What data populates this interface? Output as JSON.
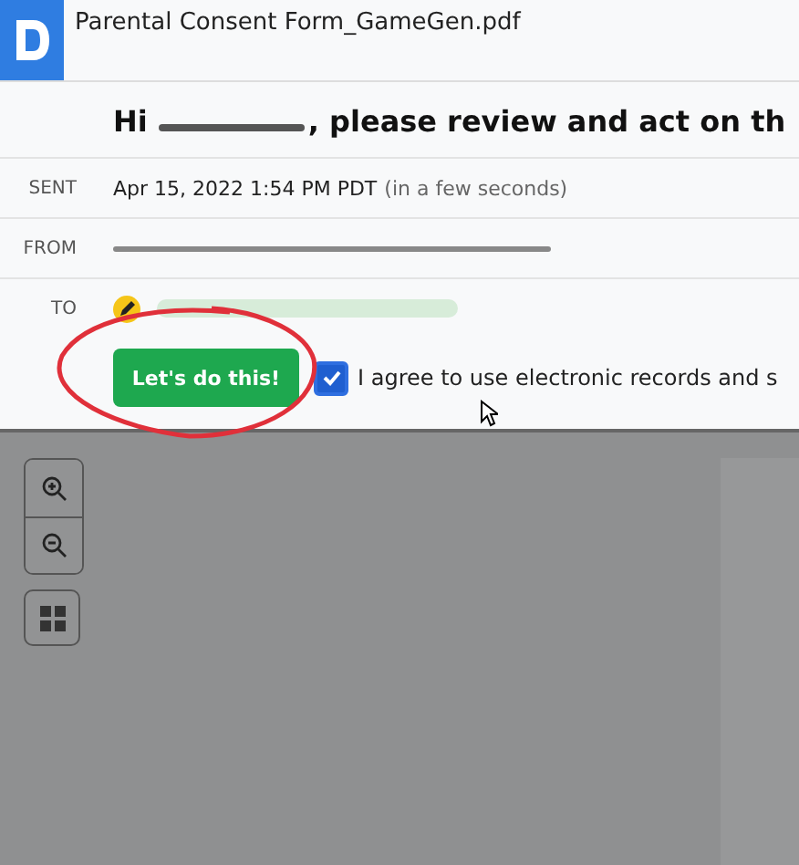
{
  "document": {
    "title": "Parental Consent Form_GameGen.pdf"
  },
  "heading": {
    "greeting": "Hi",
    "rest": ", please review and act on th"
  },
  "details": [
    {
      "kind": "sent",
      "label": "SENT",
      "value": "Apr 15, 2022 1:54 PM PDT",
      "note": "(in a few seconds)"
    },
    {
      "kind": "from",
      "label": "FROM"
    },
    {
      "kind": "to",
      "label": "TO"
    }
  ],
  "action": {
    "button": "Let's do this!",
    "agree": {
      "checked": true,
      "label": "I agree to use electronic records and s"
    }
  }
}
